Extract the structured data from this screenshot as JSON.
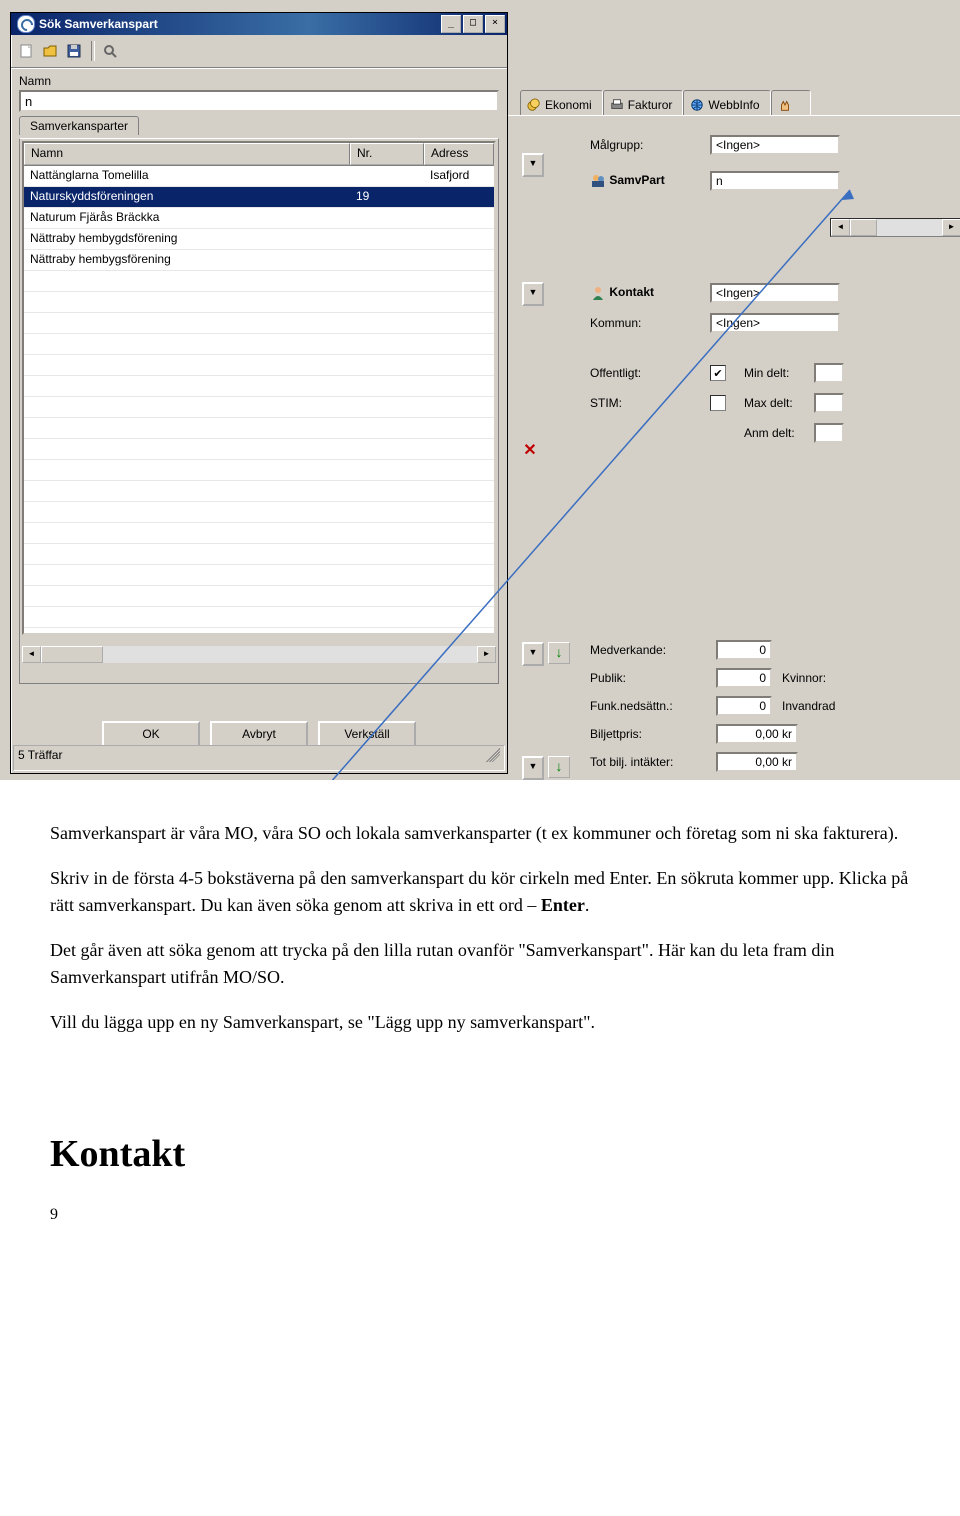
{
  "dialog": {
    "title": "Sök Samverkanspart",
    "name_label": "Namn",
    "name_value": "n",
    "subtab": "Samverkansparter",
    "columns": {
      "name": "Namn",
      "nr": "Nr.",
      "adr": "Adress"
    },
    "rows": [
      {
        "name": "Nattänglarna Tomelilla",
        "nr": "",
        "adr": "Isafjord"
      },
      {
        "name": "Naturskyddsföreningen",
        "nr": "19",
        "adr": "",
        "selected": true
      },
      {
        "name": "Naturum Fjärås Bräckka",
        "nr": "",
        "adr": ""
      },
      {
        "name": "Nättraby hembygdsförening",
        "nr": "",
        "adr": ""
      },
      {
        "name": "Nättraby hembygsförening",
        "nr": "",
        "adr": ""
      }
    ],
    "buttons": {
      "ok": "OK",
      "cancel": "Avbryt",
      "apply": "Verkställ"
    },
    "status": "5 Träffar"
  },
  "bg_tabs": {
    "ekonomi": "Ekonomi",
    "fakturor": "Fakturor",
    "webbinfo": "WebbInfo"
  },
  "right_form": {
    "malgrupp_label": "Målgrupp:",
    "malgrupp_value": "<Ingen>",
    "samvpart_label": "SamvPart",
    "samvpart_value": "n",
    "kontakt_label": "Kontakt",
    "kontakt_value": "<Ingen>",
    "kommun_label": "Kommun:",
    "kommun_value": "<Ingen>",
    "offentligt_label": "Offentligt:",
    "stim_label": "STIM:",
    "mindelt_label": "Min delt:",
    "maxdelt_label": "Max delt:",
    "anmdelt_label": "Anm delt:"
  },
  "stats": {
    "medverkande_label": "Medverkande:",
    "medverkande_value": "0",
    "publik_label": "Publik:",
    "publik_value": "0",
    "kvinnor_label": "Kvinnor:",
    "funk_label": "Funk.nedsättn.:",
    "funk_value": "0",
    "invandr_label": "Invandrad",
    "biljett_label": "Biljettpris:",
    "biljett_value": "0,00 kr",
    "totbilj_label": "Tot bilj. intäkter:",
    "totbilj_value": "0,00 kr"
  },
  "doc": {
    "p1a": "Samverkanspart är våra MO, våra SO och lokala samverkansparter (t ex kommuner och företag som ni ska fakturera).",
    "p2a": "Skriv in de första 4-5 bokstäverna på den samverkanspart du kör cirkeln med Enter. En sökruta kommer upp. Klicka på rätt samverkanspart. Du kan även söka genom att skriva in ett ord – ",
    "p2b": "Enter",
    "p2c": ".",
    "p3": "Det går även att söka genom att trycka på den lilla rutan ovanför \"Samverkanspart\". Här kan du leta fram din Samverkanspart utifrån MO/SO.",
    "p4": "Vill du lägga upp en ny Samverkanspart, se \"Lägg upp ny samverkanspart\".",
    "kontakt": "Kontakt",
    "pagenum": "9"
  }
}
